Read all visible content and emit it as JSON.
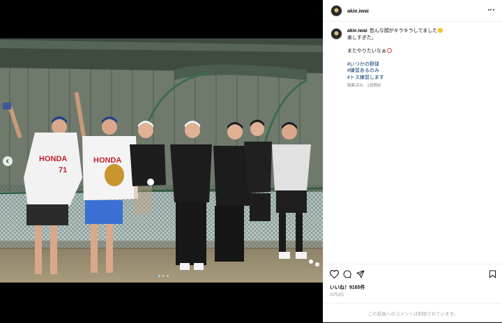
{
  "post": {
    "username": "akie.iwai",
    "caption_line1": "皆んな顔がキラキラしてました",
    "caption_line2": "楽しすぎた。",
    "caption_line3": "またやりたいなぁ",
    "hashtags": [
      "#いつかの野球",
      "#練習あるのみ",
      "#トス練習します"
    ],
    "edited_time": "編集済み · 1週間前",
    "likes": "いいね！9165件",
    "date": "10月3日",
    "comments_disabled": "この投稿へのコメントは制限されています。"
  },
  "photo": {
    "jersey_text_1": "HONDA",
    "jersey_number_1": "71",
    "jersey_text_2": "HONDA",
    "carousel_pages": 4,
    "carousel_active_index": 0
  },
  "icons": {
    "more": "more-horizontal-icon",
    "like": "heart-icon",
    "comment": "comment-icon",
    "share": "share-icon",
    "save": "bookmark-icon",
    "prev": "chevron-left-icon"
  },
  "colors": {
    "hashtag": "#00376b",
    "meta": "#8e8e8e",
    "carousel_active": "#4a9be8"
  }
}
